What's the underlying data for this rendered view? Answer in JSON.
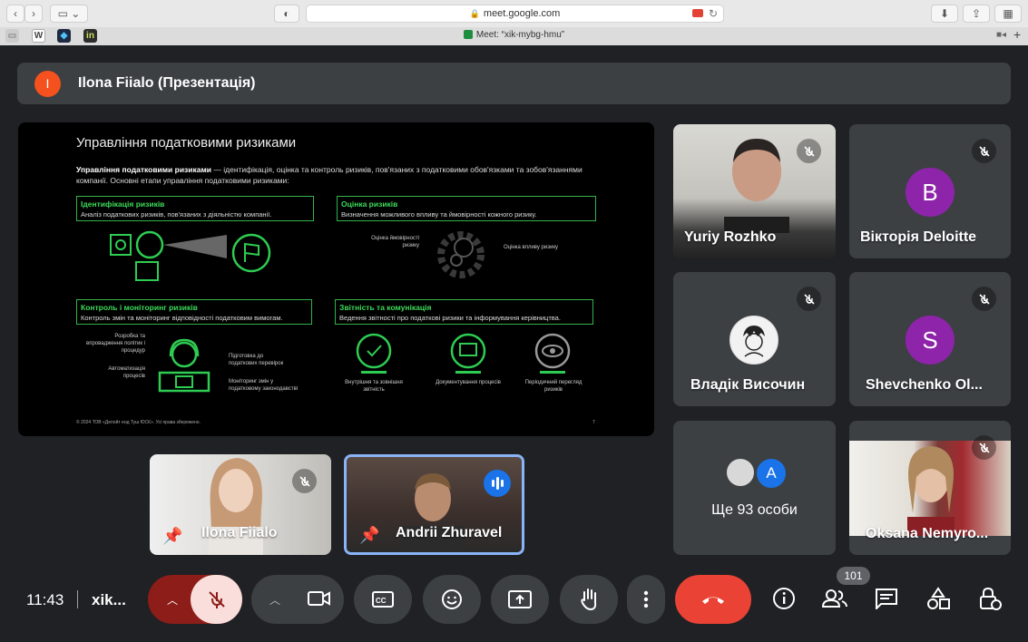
{
  "browser": {
    "url": "meet.google.com",
    "tab_title": "Meet: “xik-mybg-hmu”",
    "bookmarks": [
      "W",
      "",
      "in"
    ]
  },
  "presenter": {
    "initial": "I",
    "title": "Ilona Fiialo (Презентація)",
    "avatar_color": "#f4511e"
  },
  "slide": {
    "title": "Управління податковими ризиками",
    "intro_bold": "Управління податковими ризиками",
    "intro_rest": " — ідентифікація, оцінка та контроль ризиків, пов'язаних з податковими обов'язками та зобов'язаннями компанії. Основні етапи управління податковими ризиками:",
    "boxes": [
      {
        "heading": "Ідентифікація ризиків",
        "text": "Аналіз податкових ризиків, пов'язаних з діяльністю компанії."
      },
      {
        "heading": "Оцінка ризиків",
        "text": "Визначення можливого впливу та ймовірності кожного ризику."
      },
      {
        "heading": "Контроль і моніторинг ризиків",
        "text": "Контроль змін та моніторинг відповідності податковим вимогам."
      },
      {
        "heading": "Звітність та комунікація",
        "text": "Ведення звітності про податкові ризики та інформування керівництва."
      }
    ],
    "labels": {
      "prob": "Оцінка ймовірності ризику",
      "impact": "Оцінка впливу ризику",
      "policies": "Розробка та впровадження політик і процедур",
      "automation": "Автоматизація процесів",
      "prep": "Підготовка до податкових перевірок",
      "monitor": "Моніторинг змін у податковому законодавстві",
      "reporting": "Внутрішня та зовнішня звітність",
      "documenting": "Документування процесів",
      "review": "Періодичний перегляд ризиків"
    },
    "footer": "© 2024 ТОВ «Делойт енд Туш ЮСК». Усі права збережено.",
    "page": "7"
  },
  "participants": {
    "yuriy": "Yuriy Rozhko",
    "viktoria": {
      "name": "Вікторія Deloitte",
      "initial": "B",
      "color": "#8e24aa"
    },
    "vladik": "Владік Височин",
    "shevchenko": {
      "name": "Shevchenko Ol...",
      "initial": "S",
      "color": "#8e24aa"
    },
    "others": {
      "label": "Ще 93 особи",
      "initial": "A",
      "color": "#1a73e8"
    },
    "oksana": "Oksana Nemyro...",
    "ilona": "Ilona Fiialo",
    "andrii": "Andrii Zhuravel"
  },
  "controls": {
    "time": "11:43",
    "meeting_code": "xik...",
    "people_count": "101"
  },
  "colors": {
    "hangup": "#ea4335",
    "mic_off_bg": "#f9dedc",
    "mic_off_dark": "#8c1d18",
    "accent": "#8ab4f8"
  }
}
